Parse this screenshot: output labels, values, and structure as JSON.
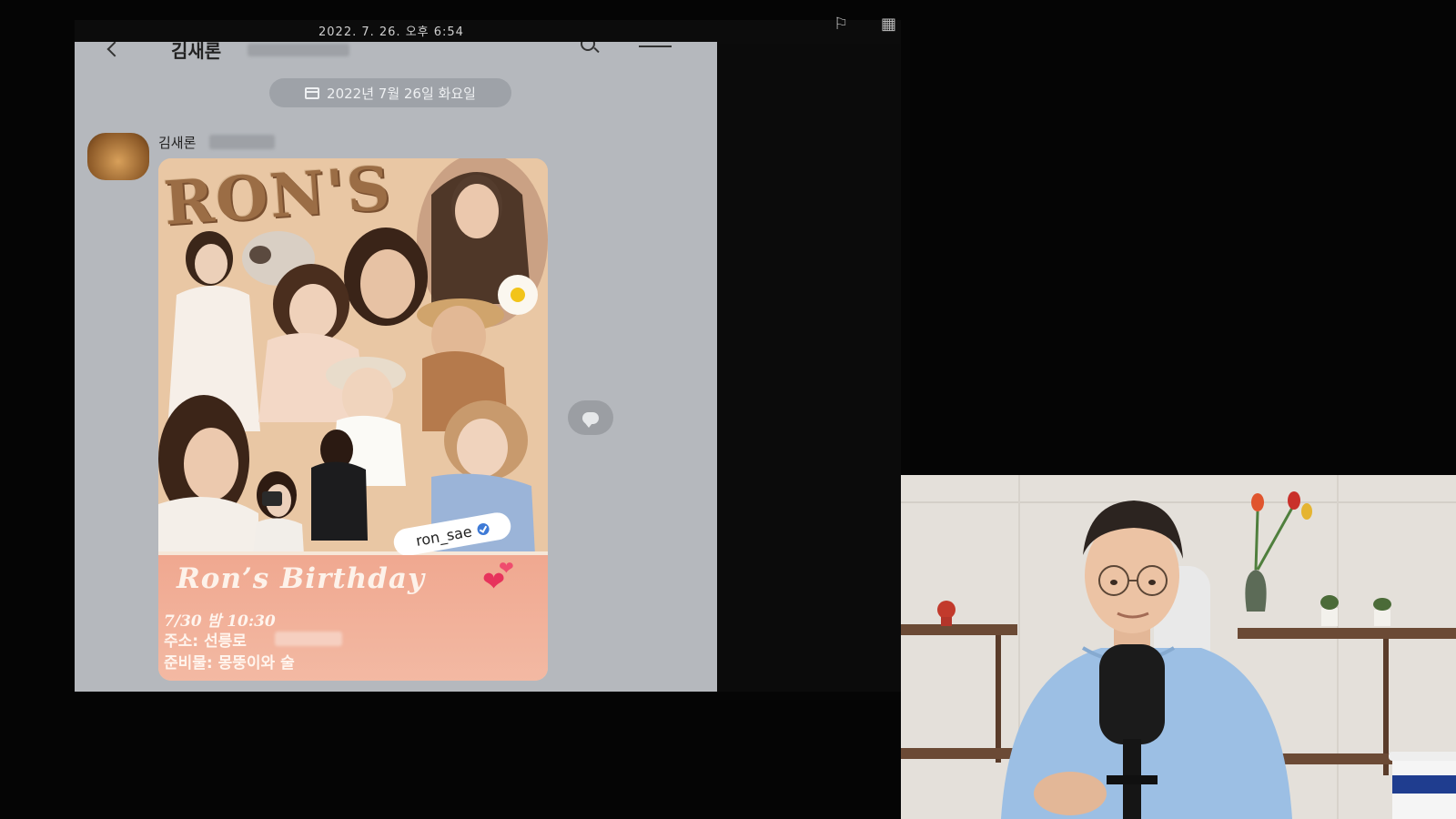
{
  "phone": {
    "status_time": "2022. 7. 26. 오후 6:54",
    "chat_title": "김새론",
    "date_divider": "2022년 7월 26일 화요일",
    "sender_name": "김새론"
  },
  "poster": {
    "title": "RON'S",
    "handle": "ron_sae",
    "birthday": "Ron’s Birthday",
    "time": "7/30 밤 10:30",
    "address": "주소: 선릉로",
    "bring": "준비물: 몽뚱이와 술"
  },
  "colors": {
    "chat_bg": "#b5b8bd",
    "poster_bottom": "#f0a890",
    "hearts": "#e7335c"
  },
  "icons": [
    "back-icon",
    "search-icon",
    "menu-icon",
    "calendar-icon",
    "verified-icon",
    "hearts-icon",
    "speech-icon"
  ]
}
